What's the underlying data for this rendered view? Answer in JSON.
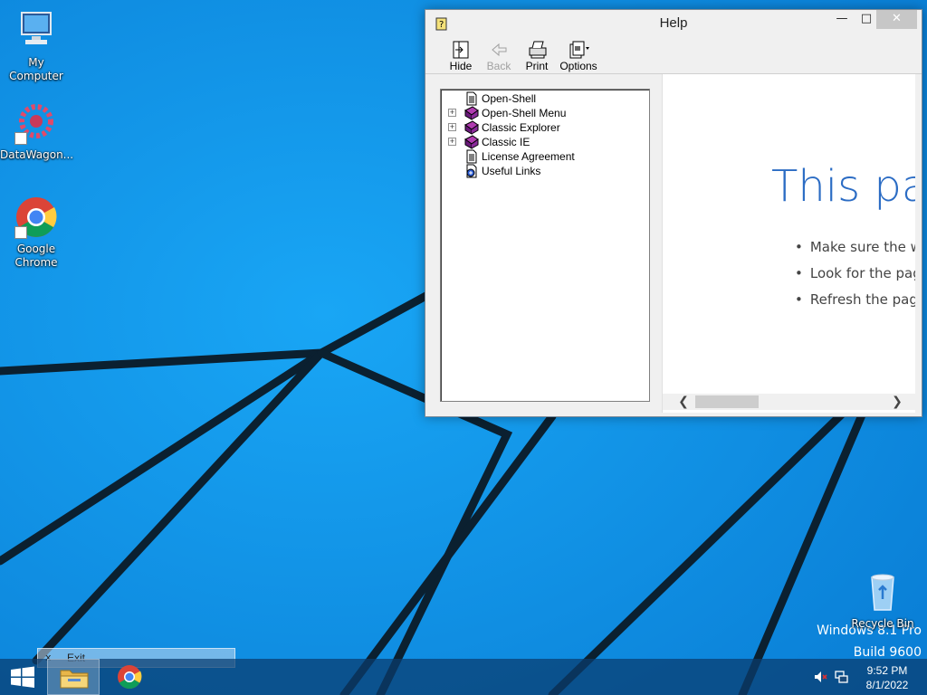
{
  "desktop": {
    "icons": [
      {
        "label": "My Computer",
        "icon": "computer-icon"
      },
      {
        "label": "DataWagon...",
        "icon": "datawagon-icon"
      },
      {
        "label": "Google Chrome",
        "icon": "chrome-icon"
      },
      {
        "label": "Recycle Bin",
        "icon": "recycle-bin-icon"
      }
    ],
    "watermark": {
      "line1": "Windows 8.1 Pro",
      "line2": "Build 9600"
    }
  },
  "help_window": {
    "title": "Help",
    "toolbar": {
      "hide_label": "Hide",
      "back_label": "Back",
      "print_label": "Print",
      "options_label": "Options"
    },
    "tree": [
      {
        "label": "Open-Shell",
        "icon": "page-icon",
        "expandable": false
      },
      {
        "label": "Open-Shell Menu",
        "icon": "book-icon",
        "expandable": true
      },
      {
        "label": "Classic Explorer",
        "icon": "book-icon",
        "expandable": true
      },
      {
        "label": "Classic IE",
        "icon": "book-icon",
        "expandable": true
      },
      {
        "label": "License Agreement",
        "icon": "page-icon",
        "expandable": false
      },
      {
        "label": "Useful Links",
        "icon": "web-page-icon",
        "expandable": false
      }
    ],
    "content": {
      "heading": "This pag",
      "bullets": [
        "Make sure the wel",
        "Look for the page",
        "Refresh the page i"
      ]
    }
  },
  "tooltip": {
    "close": "x",
    "label": "Exit"
  },
  "taskbar": {
    "clock_time": "9:52 PM",
    "clock_date": "8/1/2022"
  },
  "colors": {
    "wallpaper": "#0d8ee6",
    "heading": "#2b6cc4",
    "taskbar": "#0a3c6e"
  }
}
